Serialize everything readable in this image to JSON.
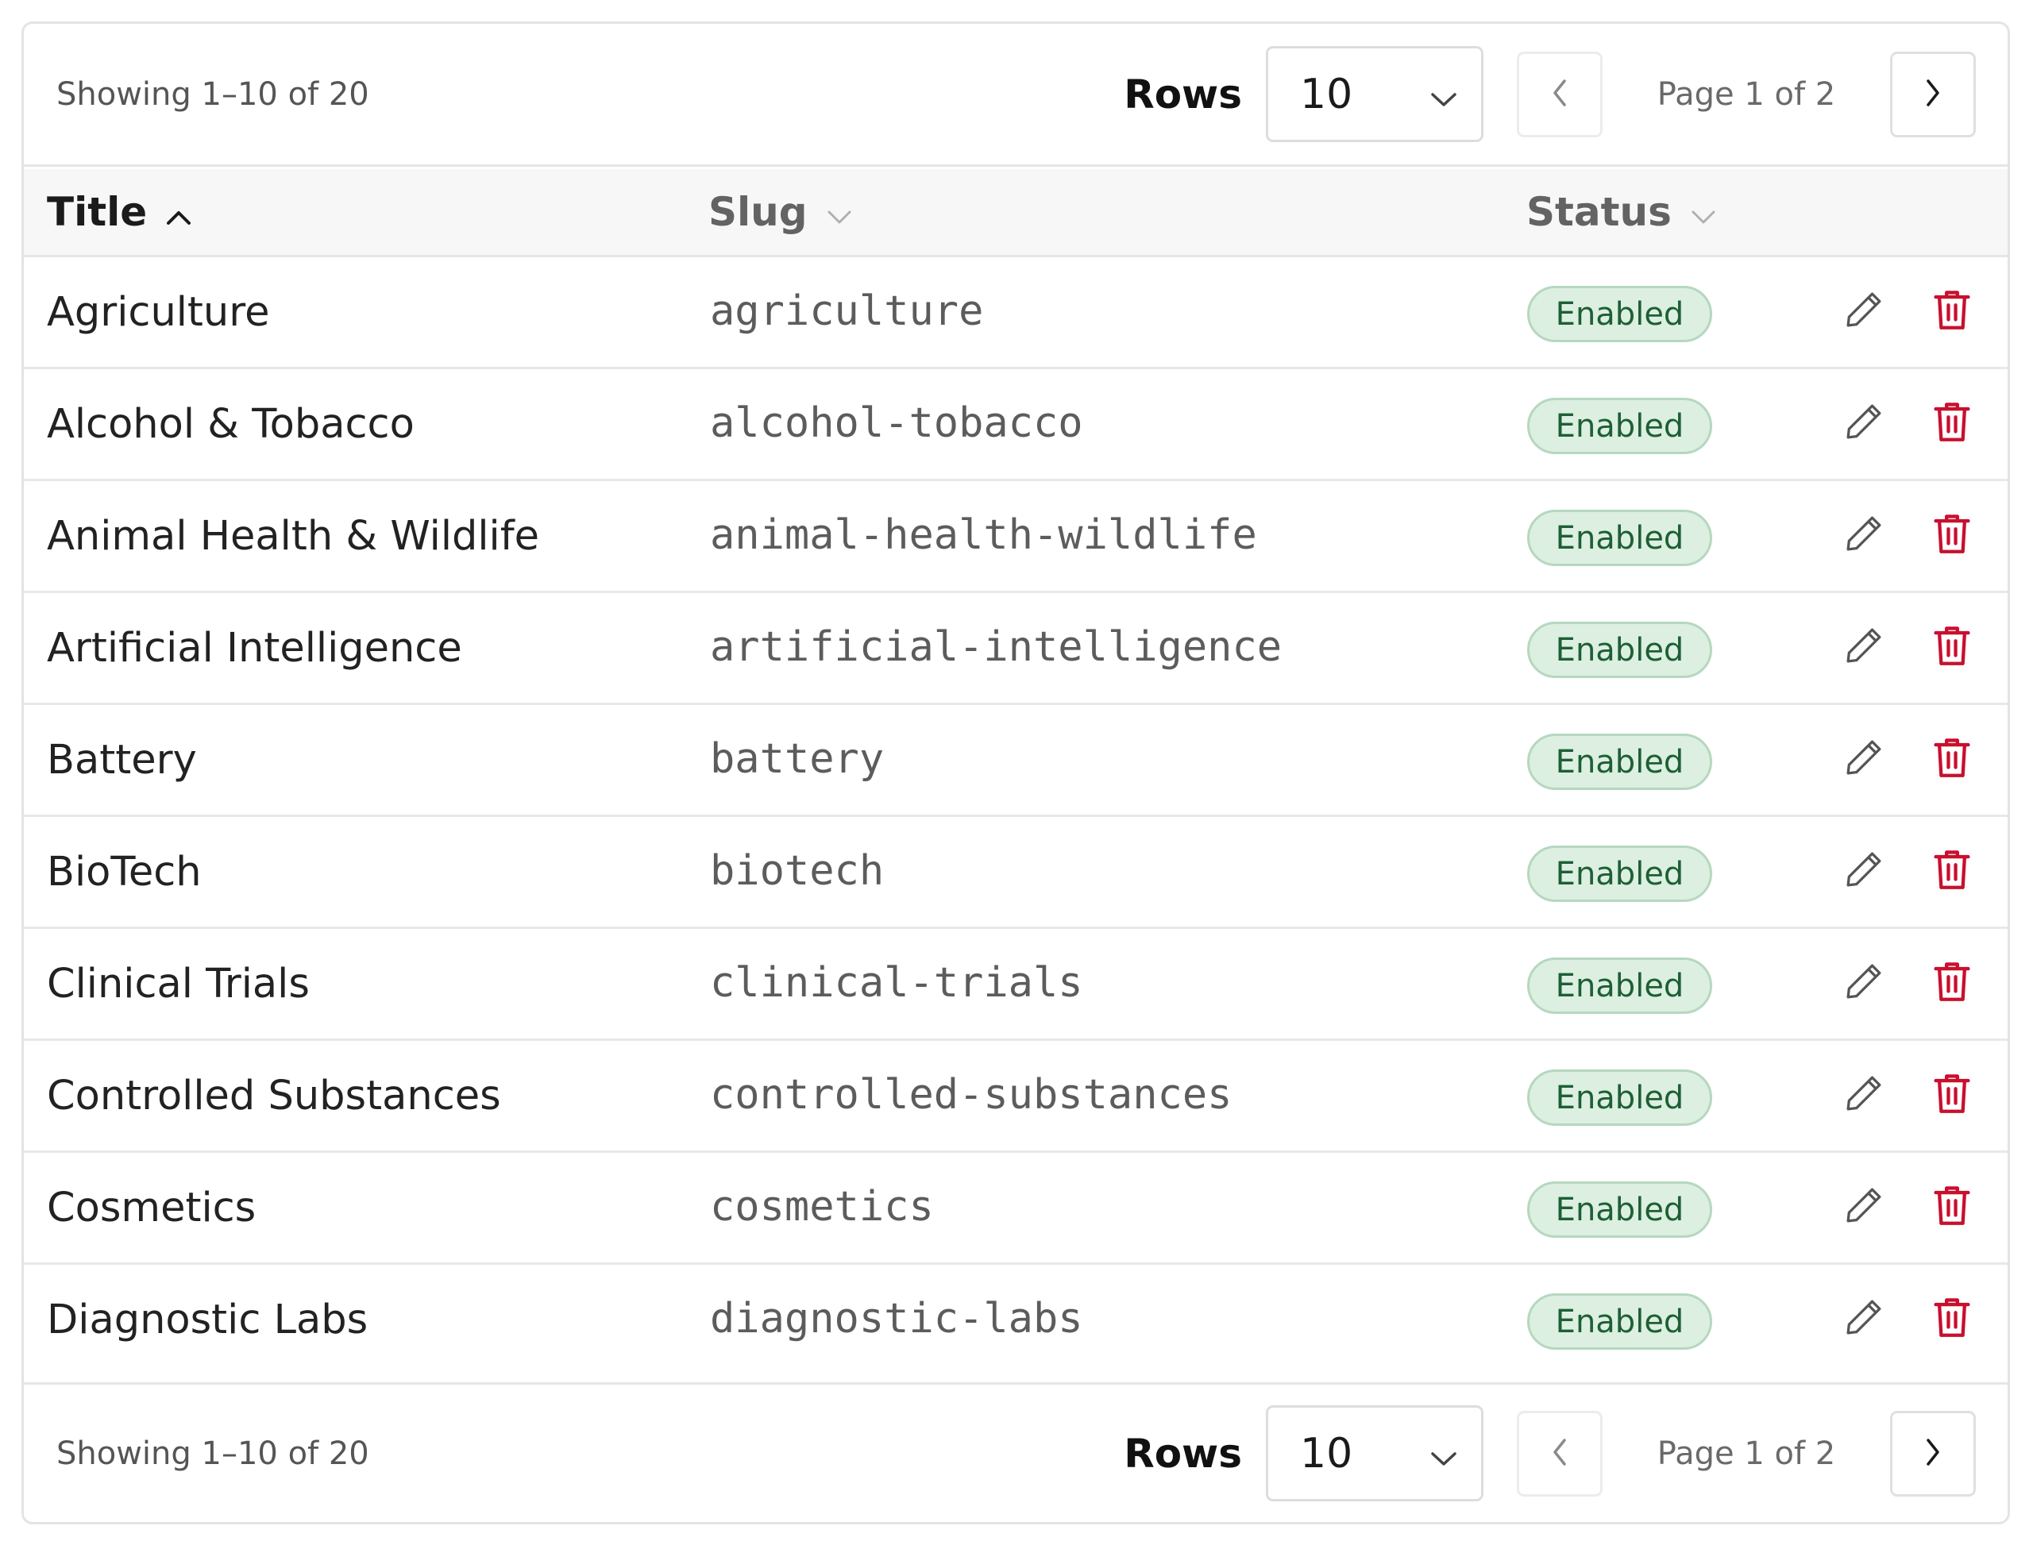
{
  "pagination": {
    "showing": "Showing 1–10 of 20",
    "rows_label": "Rows",
    "rows_value": "10",
    "page_info": "Page 1 of 2"
  },
  "table": {
    "columns": [
      {
        "label": "Title",
        "sort": "ascending",
        "sort_icon": "chevron-up-icon"
      },
      {
        "label": "Slug",
        "sort": "none",
        "sort_icon": "chevron-down-icon"
      },
      {
        "label": "Status",
        "sort": "none",
        "sort_icon": "chevron-down-icon"
      }
    ],
    "rows": [
      {
        "title": "Agriculture",
        "slug": "agriculture",
        "status": "Enabled"
      },
      {
        "title": "Alcohol & Tobacco",
        "slug": "alcohol-tobacco",
        "status": "Enabled"
      },
      {
        "title": "Animal Health & Wildlife",
        "slug": "animal-health-wildlife",
        "status": "Enabled"
      },
      {
        "title": "Artificial Intelligence",
        "slug": "artificial-intelligence",
        "status": "Enabled"
      },
      {
        "title": "Battery",
        "slug": "battery",
        "status": "Enabled"
      },
      {
        "title": "BioTech",
        "slug": "biotech",
        "status": "Enabled"
      },
      {
        "title": "Clinical Trials",
        "slug": "clinical-trials",
        "status": "Enabled"
      },
      {
        "title": "Controlled Substances",
        "slug": "controlled-substances",
        "status": "Enabled"
      },
      {
        "title": "Cosmetics",
        "slug": "cosmetics",
        "status": "Enabled"
      },
      {
        "title": "Diagnostic Labs",
        "slug": "diagnostic-labs",
        "status": "Enabled"
      }
    ],
    "row_actions": [
      "pencil-icon",
      "trash-icon"
    ]
  },
  "colors": {
    "badge_bg": "#dcefe1",
    "badge_text": "#1e5f34",
    "delete_icon": "#c8102e",
    "edit_icon": "#555555",
    "header_bg": "#f7f7f7"
  }
}
